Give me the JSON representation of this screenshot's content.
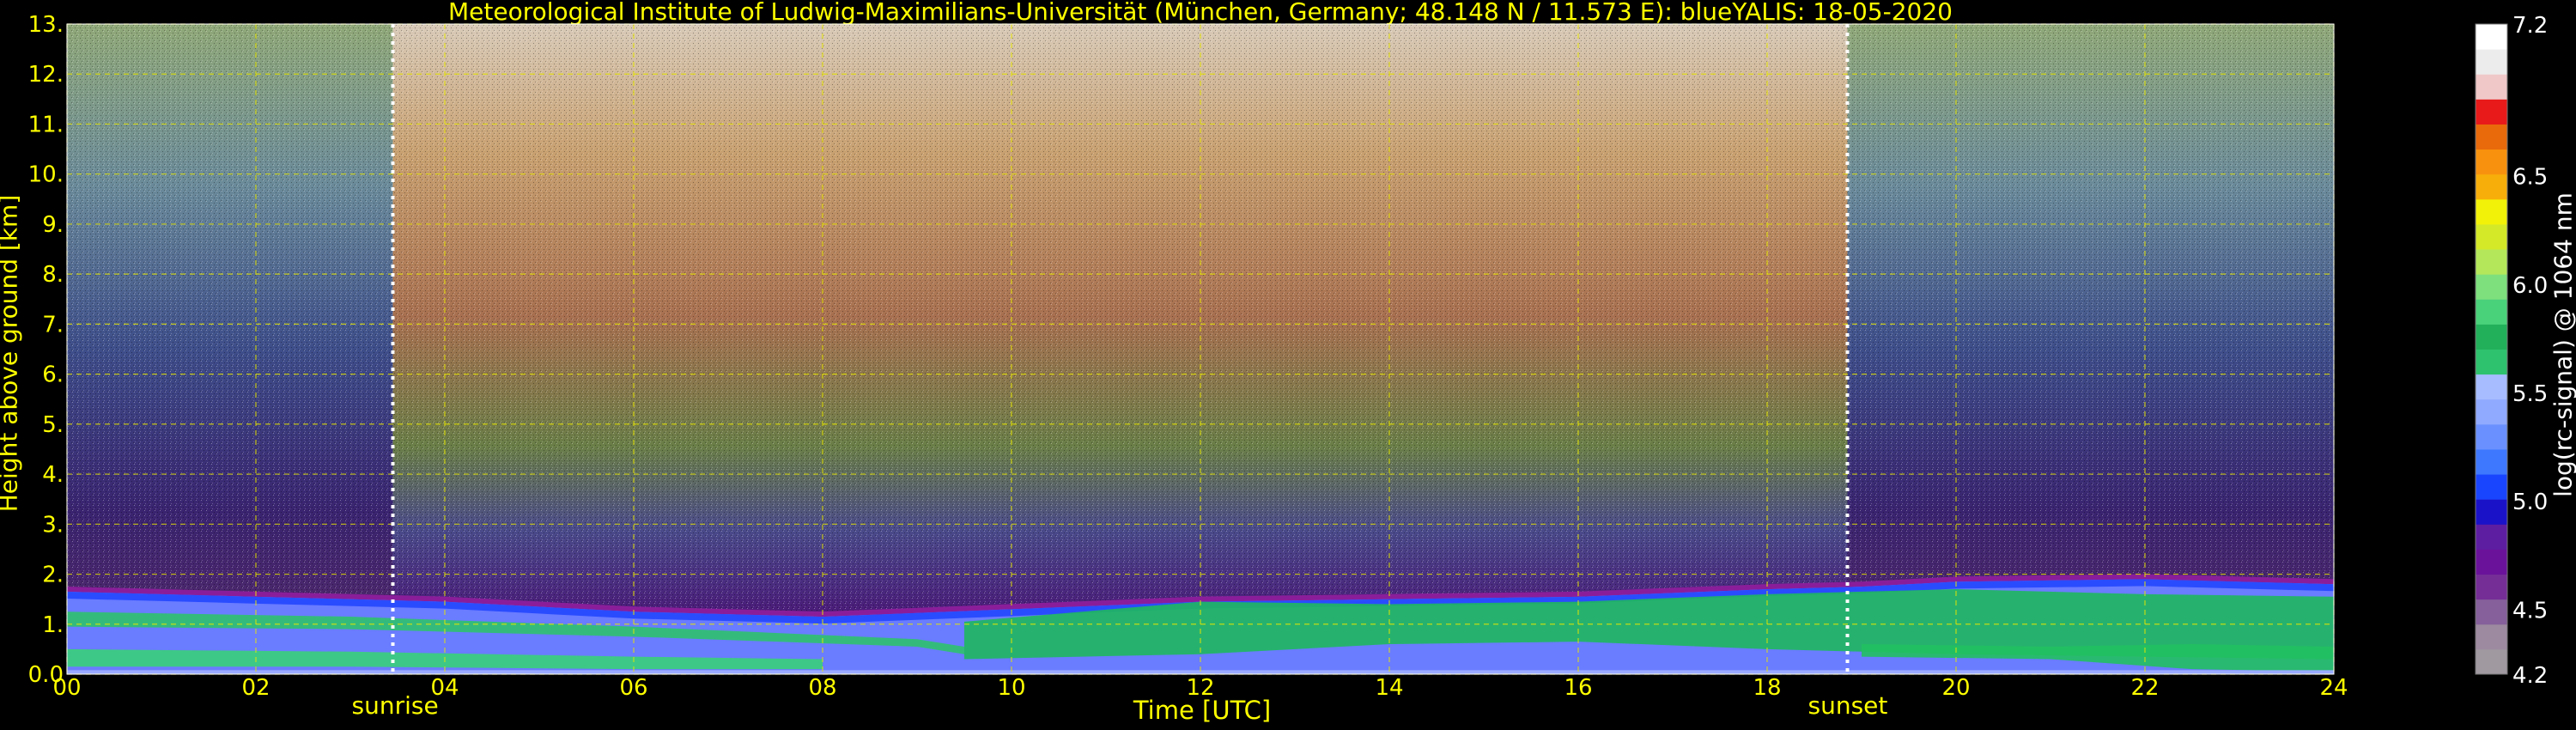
{
  "chart_data": {
    "type": "heatmap",
    "title": "Meteorological Institute of Ludwig-Maximilians-Universität (München, Germany; 48.148 N / 11.573 E):    blueYALIS: 18-05-2020",
    "xlabel": "Time [UTC]",
    "ylabel": "Height above ground [km]",
    "xlim": [
      0,
      24
    ],
    "ylim": [
      0,
      13
    ],
    "x_ticks": [
      "00",
      "02",
      "04",
      "06",
      "08",
      "10",
      "12",
      "14",
      "16",
      "18",
      "20",
      "22",
      "24"
    ],
    "y_ticks": [
      "0.0",
      "1.",
      "2.",
      "3.",
      "4.",
      "5.",
      "6.",
      "7.",
      "8.",
      "9.",
      "10.",
      "11.",
      "12.",
      "13."
    ],
    "grid": true,
    "markers": [
      {
        "label": "sunrise",
        "x": 3.45
      },
      {
        "label": "sunset",
        "x": 18.85
      }
    ],
    "colorbar": {
      "label": "log(rc-signal) @ 1064 nm",
      "range": [
        4.2,
        7.2
      ],
      "ticks": [
        "4.2",
        "4.5",
        "5.0",
        "5.5",
        "6.0",
        "6.5",
        "7.2"
      ],
      "colors": [
        "#a09aa0",
        "#9d8aa0",
        "#85609a",
        "#752e96",
        "#6a129a",
        "#5e1ea2",
        "#1a12c8",
        "#1a45ff",
        "#3e78ff",
        "#6a90ff",
        "#90aaff",
        "#a6bcff",
        "#2fc26e",
        "#22b05a",
        "#4ad27a",
        "#7ee07c",
        "#b4e85a",
        "#d4ea28",
        "#f2f208",
        "#f8ae0a",
        "#f8920e",
        "#e86a0a",
        "#e81a1a",
        "#f0c8c8",
        "#ececec",
        "#ffffff"
      ]
    },
    "layers": [
      {
        "name": "boundary layer top",
        "x": [
          0,
          2,
          4,
          6,
          8,
          10,
          12,
          14,
          16,
          18,
          19,
          20,
          22,
          24
        ],
        "height_km": [
          1.7,
          1.6,
          1.5,
          1.3,
          1.2,
          1.35,
          1.5,
          1.55,
          1.6,
          1.75,
          1.8,
          1.9,
          1.95,
          1.85
        ]
      }
    ]
  }
}
